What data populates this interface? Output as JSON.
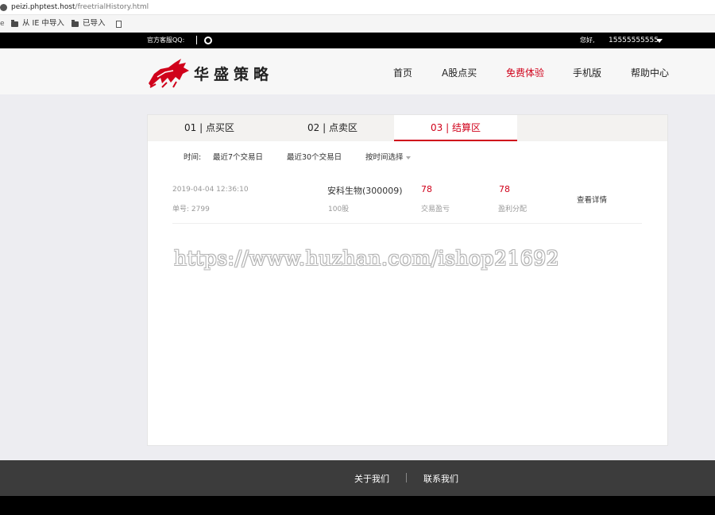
{
  "browser": {
    "url_host": "peizi.phptest.host",
    "url_path": "/freetrialHistory.html",
    "bookmarks": [
      "从 IE 中导入",
      "已导入"
    ]
  },
  "topbar": {
    "qq_label": "官方客服QQ:",
    "greeting": "您好,",
    "username": "15555555555"
  },
  "header": {
    "brand": "华盛策略",
    "nav": [
      "首页",
      "A股点买",
      "免费体验",
      "手机版",
      "帮助中心"
    ],
    "active_nav": "免费体验"
  },
  "tabs": [
    "01 | 点买区",
    "02 | 点卖区",
    "03 | 结算区"
  ],
  "active_tab": "03 | 结算区",
  "filters": {
    "label": "时间:",
    "options": [
      "最近7个交易日",
      "最近30个交易日",
      "按时间选择"
    ]
  },
  "record": {
    "datetime": "2019-04-04 12:36:10",
    "order_no": "单号: 2799",
    "stock": "安科生物(300009)",
    "shares": "100股",
    "trade_pl": "78",
    "trade_pl_label": "交易盈亏",
    "profit_share": "78",
    "profit_share_label": "盈利分配",
    "detail_link": "查看详情"
  },
  "watermark": "https://www.huzhan.com/ishop21692",
  "footer": [
    "关于我们",
    "联系我们"
  ],
  "colors": {
    "accent": "#d0021b",
    "topbar": "#000000",
    "footer": "#3c3c3c"
  }
}
